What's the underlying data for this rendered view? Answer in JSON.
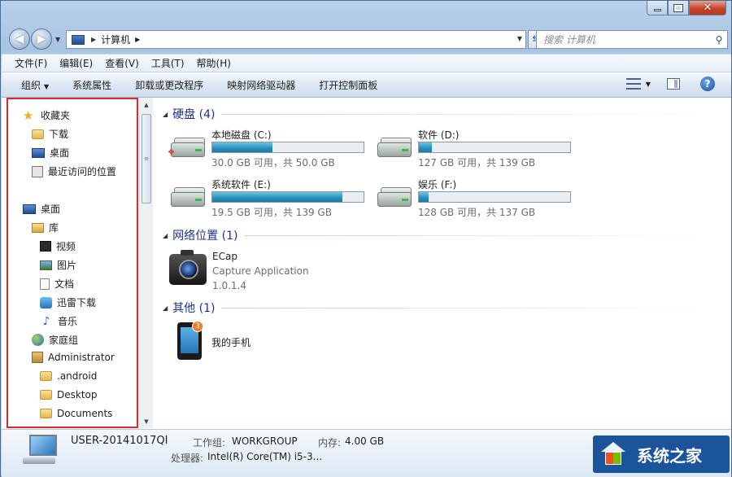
{
  "window": {
    "caption_buttons": [
      "minimize",
      "maximize",
      "close"
    ]
  },
  "address_bar": {
    "location": "计算机",
    "search_placeholder": "搜索 计算机"
  },
  "menu": [
    "文件(F)",
    "编辑(E)",
    "查看(V)",
    "工具(T)",
    "帮助(H)"
  ],
  "commands": {
    "organize": "组织",
    "system_properties": "系统属性",
    "uninstall": "卸载或更改程序",
    "map_drive": "映射网络驱动器",
    "control_panel": "打开控制面板"
  },
  "nav_tree": {
    "favorites": {
      "label": "收藏夹",
      "items": [
        "下载",
        "桌面",
        "最近访问的位置"
      ]
    },
    "desktop": "桌面",
    "library": {
      "label": "库",
      "items": [
        "视频",
        "图片",
        "文档",
        "迅雷下载",
        "音乐"
      ]
    },
    "homegroup": "家庭组",
    "admin": {
      "label": "Administrator",
      "items": [
        ".android",
        "Desktop",
        "Documents"
      ]
    }
  },
  "groups": {
    "hard_disks": "硬盘 (4)",
    "network": "网络位置 (1)",
    "other": "其他 (1)"
  },
  "drives": [
    {
      "name": "本地磁盘 (C:)",
      "free": "30.0 GB 可用，共 50.0 GB",
      "used_fraction": 0.4,
      "system": true
    },
    {
      "name": "软件 (D:)",
      "free": "127 GB 可用，共 139 GB",
      "used_fraction": 0.086,
      "system": false
    },
    {
      "name": "系统软件 (E:)",
      "free": "19.5 GB 可用，共 139 GB",
      "used_fraction": 0.86,
      "system": false
    },
    {
      "name": "娱乐 (F:)",
      "free": "128 GB 可用，共 137 GB",
      "used_fraction": 0.066,
      "system": false
    }
  ],
  "network_item": {
    "name": "ECap",
    "description": "Capture Application",
    "version": "1.0.1.4"
  },
  "other_item": {
    "name": "我的手机",
    "badge": "3"
  },
  "details": {
    "computer_name": "USER-20141017QI",
    "workgroup_label": "工作组:",
    "workgroup_value": "WORKGROUP",
    "memory_label": "内存:",
    "memory_value": "4.00 GB",
    "cpu_label": "处理器:",
    "cpu_value": "Intel(R) Core(TM) i5-3..."
  },
  "watermark": "系统之家",
  "colors": {
    "highlight_frame": "#e0292d",
    "group_title": "#1e3287",
    "drive_fill": "#2a93bf"
  }
}
